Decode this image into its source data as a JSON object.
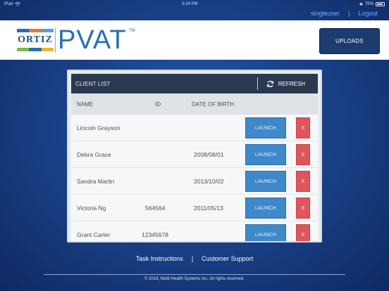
{
  "status_bar": {
    "carrier": "iPad",
    "time": "5:24 PM",
    "battery": "75%"
  },
  "user": {
    "username": "singleuser",
    "separator": "|",
    "logout_label": "Logout"
  },
  "header": {
    "logo_ortiz": "ORTIZ",
    "logo_pvat": "PVAT",
    "logo_tm": "TM",
    "uploads_label": "UPLOADS"
  },
  "colors": {
    "background": "#1a428a",
    "header_bar": "#2b3950",
    "launch": "#3f88c9",
    "delete": "#e0555b",
    "uploads": "#1c3b6e",
    "logo_blue": "#2a6fb0"
  },
  "client_list": {
    "title": "CLIENT LIST",
    "refresh_label": "REFRESH",
    "refresh_icon": "refresh-icon",
    "columns": [
      "NAME",
      "ID",
      "DATE OF BIRTH"
    ],
    "launch_label": "LAUNCH",
    "delete_label": "X",
    "rows": [
      {
        "name": "Lincoln Grayson",
        "id": "",
        "dob": ""
      },
      {
        "name": "Debra Grace",
        "id": "",
        "dob": "2008/08/01"
      },
      {
        "name": "Sandra Martin",
        "id": "",
        "dob": "2013/10/02"
      },
      {
        "name": "Victoria Ng",
        "id": "564564",
        "dob": "2011/05/13"
      },
      {
        "name": "Grant Carter",
        "id": "12345678",
        "dob": ""
      }
    ]
  },
  "footer": {
    "task_instructions": "Task Instructions",
    "separator": "|",
    "customer_support": "Customer Support",
    "copyright": "© 2018, Multi-Health Systems Inc. All rights reserved."
  }
}
